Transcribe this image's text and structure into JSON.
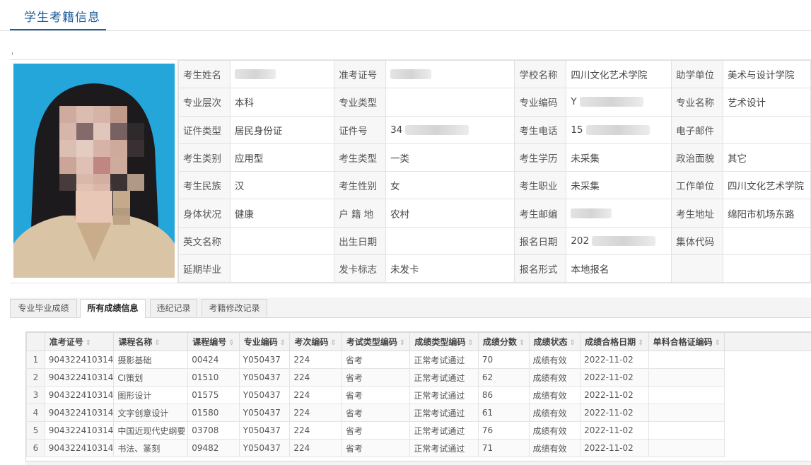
{
  "page": {
    "title": "学生考籍信息"
  },
  "info": {
    "rows": [
      [
        {
          "label": "考生姓名",
          "value": "",
          "masked": true
        },
        {
          "label": "准考证号",
          "value": "",
          "masked": true
        },
        {
          "label": "学校名称",
          "value": "四川文化艺术学院"
        },
        {
          "label": "助学单位",
          "value": "美术与设计学院"
        }
      ],
      [
        {
          "label": "专业层次",
          "value": "本科"
        },
        {
          "label": "专业类型",
          "value": ""
        },
        {
          "label": "专业编码",
          "value": "Y",
          "masked": true
        },
        {
          "label": "专业名称",
          "value": "艺术设计"
        }
      ],
      [
        {
          "label": "证件类型",
          "value": "居民身份证"
        },
        {
          "label": "证件号",
          "value": "34",
          "masked": true
        },
        {
          "label": "考生电话",
          "value": "15",
          "masked": true
        },
        {
          "label": "电子邮件",
          "value": ""
        }
      ],
      [
        {
          "label": "考生类别",
          "value": "应用型"
        },
        {
          "label": "考生类型",
          "value": "一类"
        },
        {
          "label": "考生学历",
          "value": "未采集"
        },
        {
          "label": "政治面貌",
          "value": "其它"
        }
      ],
      [
        {
          "label": "考生民族",
          "value": "汉"
        },
        {
          "label": "考生性别",
          "value": "女"
        },
        {
          "label": "考生职业",
          "value": "未采集"
        },
        {
          "label": "工作单位",
          "value": "四川文化艺术学院"
        }
      ],
      [
        {
          "label": "身体状况",
          "value": "健康"
        },
        {
          "label": "户 籍 地",
          "value": "农村"
        },
        {
          "label": "考生邮编",
          "value": "",
          "masked": true
        },
        {
          "label": "考生地址",
          "value": "绵阳市机场东路"
        }
      ],
      [
        {
          "label": "英文名称",
          "value": ""
        },
        {
          "label": "出生日期",
          "value": ""
        },
        {
          "label": "报名日期",
          "value": "202",
          "masked": true
        },
        {
          "label": "集体代码",
          "value": ""
        }
      ],
      [
        {
          "label": "延期毕业",
          "value": ""
        },
        {
          "label": "发卡标志",
          "value": "未发卡"
        },
        {
          "label": "报名形式",
          "value": "本地报名"
        },
        {
          "label": "",
          "value": ""
        }
      ]
    ]
  },
  "tabs": [
    {
      "label": "专业毕业成绩",
      "active": false
    },
    {
      "label": "所有成绩信息",
      "active": true
    },
    {
      "label": "违纪记录",
      "active": false
    },
    {
      "label": "考籍修改记录",
      "active": false
    }
  ],
  "grades": {
    "sort_icon": "sort-icon",
    "columns": [
      "准考证号",
      "课程名称",
      "课程编号",
      "专业编码",
      "考次编码",
      "考试类型编码",
      "成绩类型编码",
      "成绩分数",
      "成绩状态",
      "成绩合格日期",
      "单科合格证编码"
    ],
    "rows": [
      [
        "1",
        "904322410314",
        "摄影基础",
        "00424",
        "Y050437",
        "224",
        "省考",
        "正常考试通过",
        "70",
        "成绩有效",
        "2022-11-02",
        ""
      ],
      [
        "2",
        "904322410314",
        "CI策划",
        "01510",
        "Y050437",
        "224",
        "省考",
        "正常考试通过",
        "62",
        "成绩有效",
        "2022-11-02",
        ""
      ],
      [
        "3",
        "904322410314",
        "图形设计",
        "01575",
        "Y050437",
        "224",
        "省考",
        "正常考试通过",
        "86",
        "成绩有效",
        "2022-11-02",
        ""
      ],
      [
        "4",
        "904322410314",
        "文字创意设计",
        "01580",
        "Y050437",
        "224",
        "省考",
        "正常考试通过",
        "61",
        "成绩有效",
        "2022-11-02",
        ""
      ],
      [
        "5",
        "904322410314",
        "中国近现代史纲要",
        "03708",
        "Y050437",
        "224",
        "省考",
        "正常考试通过",
        "76",
        "成绩有效",
        "2022-11-02",
        ""
      ],
      [
        "6",
        "904322410314",
        "书法、篆刻",
        "09482",
        "Y050437",
        "224",
        "省考",
        "正常考试通过",
        "71",
        "成绩有效",
        "2022-11-02",
        ""
      ]
    ]
  }
}
